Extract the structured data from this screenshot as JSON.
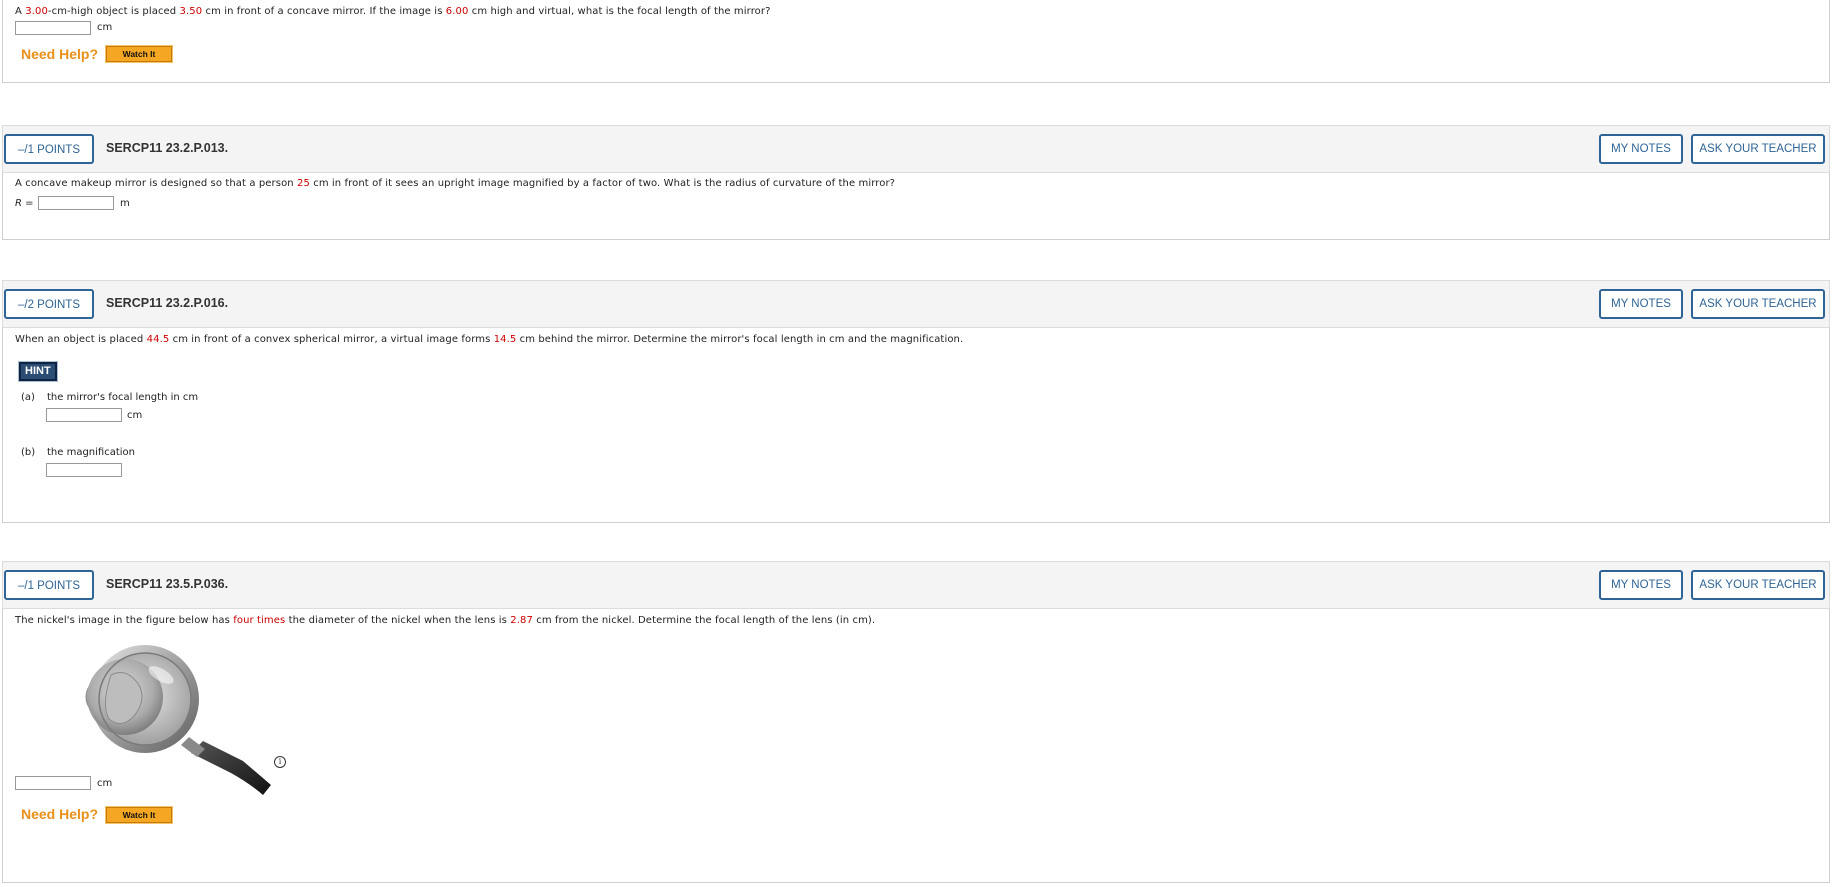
{
  "q0": {
    "text_parts": [
      "A ",
      "3.00",
      "-cm-high object is placed ",
      "3.50",
      " cm in front of a concave mirror. If the image is ",
      "6.00",
      " cm high and virtual, what is the focal length of the mirror?"
    ],
    "unit": "cm",
    "need_help": "Need Help?",
    "watch_it": "Watch It"
  },
  "q1": {
    "points": "–/1 POINTS",
    "id": "SERCP11 23.2.P.013.",
    "my_notes": "MY NOTES",
    "ask_teacher": "ASK YOUR TEACHER",
    "text_parts": [
      "A concave makeup mirror is designed so that a person ",
      "25",
      " cm in front of it sees an upright image magnified by a factor of two. What is the radius of curvature of the mirror?"
    ],
    "answer_label": "R",
    "answer_eq": " = ",
    "unit": "m"
  },
  "q2": {
    "points": "–/2 POINTS",
    "id": "SERCP11 23.2.P.016.",
    "my_notes": "MY NOTES",
    "ask_teacher": "ASK YOUR TEACHER",
    "text_parts": [
      "When an object is placed ",
      "44.5",
      " cm in front of a convex spherical mirror, a virtual image forms ",
      "14.5",
      " cm behind the mirror. Determine the mirror's focal length in cm and the magnification."
    ],
    "hint": "HINT",
    "part_a_label": "(a)",
    "part_a_text": "the mirror's focal length in cm",
    "part_a_unit": "cm",
    "part_b_label": "(b)",
    "part_b_text": "the magnification"
  },
  "q3": {
    "points": "–/1 POINTS",
    "id": "SERCP11 23.5.P.036.",
    "my_notes": "MY NOTES",
    "ask_teacher": "ASK YOUR TEACHER",
    "text_parts": [
      "The nickel's image in the figure below has ",
      "four times",
      " the diameter of the nickel when the lens is ",
      "2.87",
      " cm from the nickel. Determine the focal length of the lens (in cm)."
    ],
    "info_icon": "i",
    "unit": "cm",
    "need_help": "Need Help?",
    "watch_it": "Watch It"
  },
  "icons": {
    "info": "info-circle-icon",
    "figure": "magnifier-nickel-figure"
  },
  "colors": {
    "accent_blue": "#2f6496",
    "value_red": "#cc0000",
    "help_orange": "#e8901a",
    "hint_navy": "#2c4d73"
  }
}
